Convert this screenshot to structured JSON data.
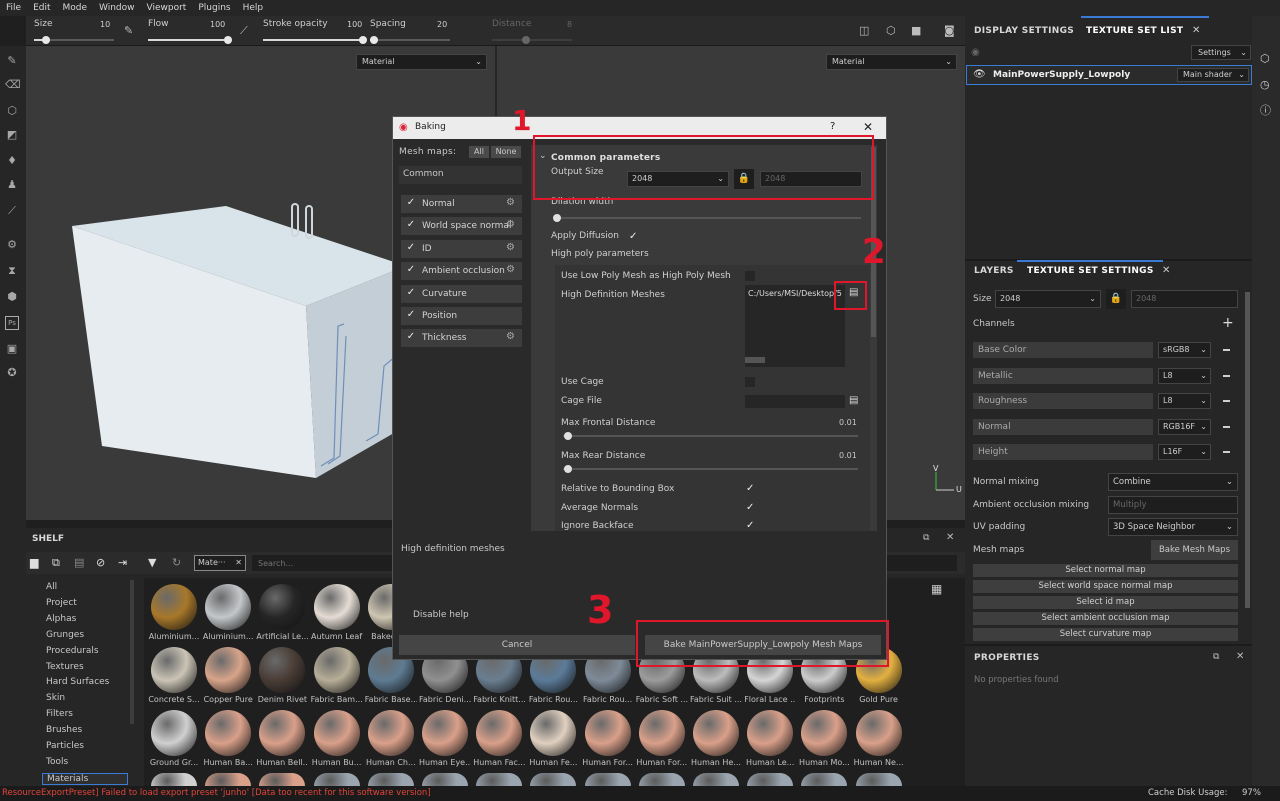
{
  "menu": [
    "File",
    "Edit",
    "Mode",
    "Window",
    "Viewport",
    "Plugins",
    "Help"
  ],
  "toolbar": {
    "size_label": "Size",
    "size_value": "10",
    "size_level": 0.15,
    "flow_label": "Flow",
    "flow_value": "100",
    "flow_level": 1.0,
    "stroke_label": "Stroke opacity",
    "stroke_value": "100",
    "stroke_level": 1.0,
    "spacing_label": "Spacing",
    "spacing_value": "20",
    "spacing_level": 0.05,
    "distance_label": "Distance",
    "distance_value": "8"
  },
  "viewport": {
    "left_material": "Material",
    "right_material": "Material",
    "axis_v": "V",
    "axis_u": "U"
  },
  "dialog": {
    "title": "Baking",
    "help": "?",
    "close": "✕",
    "mesh_maps_label": "Mesh maps:",
    "all_btn": "All",
    "none_btn": "None",
    "common": "Common",
    "maps": [
      {
        "label": "Normal",
        "checked": true
      },
      {
        "label": "World space normal",
        "checked": true
      },
      {
        "label": "ID",
        "checked": true
      },
      {
        "label": "Ambient occlusion",
        "checked": true
      },
      {
        "label": "Curvature",
        "checked": true
      },
      {
        "label": "Position",
        "checked": true
      },
      {
        "label": "Thickness",
        "checked": true
      }
    ],
    "common_params_header": "Common parameters",
    "output_size_label": "Output Size",
    "output_size_value": "2048",
    "output_size_locked": "2048",
    "dilation_label": "Dilation width",
    "apply_diffusion_label": "Apply Diffusion",
    "high_poly_header": "High poly parameters",
    "use_low_poly_label": "Use Low Poly Mesh as High Poly Mesh",
    "hd_meshes_label": "High Definition Meshes",
    "hd_meshes_path": "C:/Users/MSI/Desktop/5",
    "use_cage_label": "Use Cage",
    "cage_file_label": "Cage File",
    "max_frontal_label": "Max Frontal Distance",
    "max_frontal_value": "0.01",
    "max_rear_label": "Max Rear Distance",
    "max_rear_value": "0.01",
    "relative_bbox_label": "Relative to Bounding Box",
    "average_normals_label": "Average Normals",
    "ignore_backface_label": "Ignore Backface",
    "help_title": "High definition meshes",
    "disable_help": "Disable help",
    "cancel": "Cancel",
    "bake": "Bake MainPowerSupply_Lowpoly Mesh Maps"
  },
  "annotations": {
    "one": "1",
    "two": "2",
    "three": "3"
  },
  "shelf": {
    "title": "SHELF",
    "filter_tag": "Mate···",
    "search_placeholder": "Search...",
    "categories": [
      "All",
      "Project",
      "Alphas",
      "Grunges",
      "Procedurals",
      "Textures",
      "Hard Surfaces",
      "Skin",
      "Filters",
      "Brushes",
      "Particles",
      "Tools",
      "Materials"
    ],
    "row1": [
      "Aluminium...",
      "Aluminium...",
      "Artificial Le...",
      "Autumn Leaf",
      "Baked L..."
    ],
    "row2": [
      "Concrete S...",
      "Copper Pure",
      "Denim Rivet",
      "Fabric Bam...",
      "Fabric Base...",
      "Fabric Deni...",
      "Fabric Knitt...",
      "Fabric Rou...",
      "Fabric Rou...",
      "Fabric Soft ...",
      "Fabric Suit ...",
      "Floral Lace ...",
      "Footprints",
      "Gold Pure"
    ],
    "row3": [
      "Ground Gr...",
      "Human Ba...",
      "Human Bell...",
      "Human Bu...",
      "Human Ch...",
      "Human Eye...",
      "Human Fac...",
      "Human Fe...",
      "Human For...",
      "Human For...",
      "Human He...",
      "Human Le...",
      "Human Mo...",
      "Human Ne..."
    ]
  },
  "right": {
    "tab_display": "DISPLAY SETTINGS",
    "tab_texture_list": "TEXTURE SET LIST",
    "settings_btn": "Settings",
    "texture_set_name": "MainPowerSupply_Lowpoly",
    "shader": "Main shader",
    "tab_layers": "LAYERS",
    "tab_tss": "TEXTURE SET SETTINGS",
    "size_label": "Size",
    "size_value": "2048",
    "size_locked": "2048",
    "channels_label": "Channels",
    "channels": [
      {
        "name": "Base Color",
        "format": "sRGB8"
      },
      {
        "name": "Metallic",
        "format": "L8"
      },
      {
        "name": "Roughness",
        "format": "L8"
      },
      {
        "name": "Normal",
        "format": "RGB16F"
      },
      {
        "name": "Height",
        "format": "L16F"
      }
    ],
    "normal_mixing_label": "Normal mixing",
    "normal_mixing_value": "Combine",
    "ao_mixing_label": "Ambient occlusion mixing",
    "ao_mixing_value": "Multiply",
    "uv_padding_label": "UV padding",
    "uv_padding_value": "3D Space Neighbor",
    "mesh_maps_label": "Mesh maps",
    "bake_mesh_maps_btn": "Bake Mesh Maps",
    "select_buttons": [
      "Select normal map",
      "Select world space normal map",
      "Select id map",
      "Select ambient occlusion map",
      "Select curvature map"
    ],
    "properties_title": "PROPERTIES",
    "no_properties": "No properties found"
  },
  "status": {
    "error": "ResourceExportPreset] Failed to load export preset 'junho' [Data too recent for this software version]",
    "cache_label": "Cache Disk Usage:",
    "cache_value": "97%"
  },
  "colors": {
    "accent_red": "#e0162b",
    "error_text": "#e0453a",
    "panel": "#262626"
  }
}
